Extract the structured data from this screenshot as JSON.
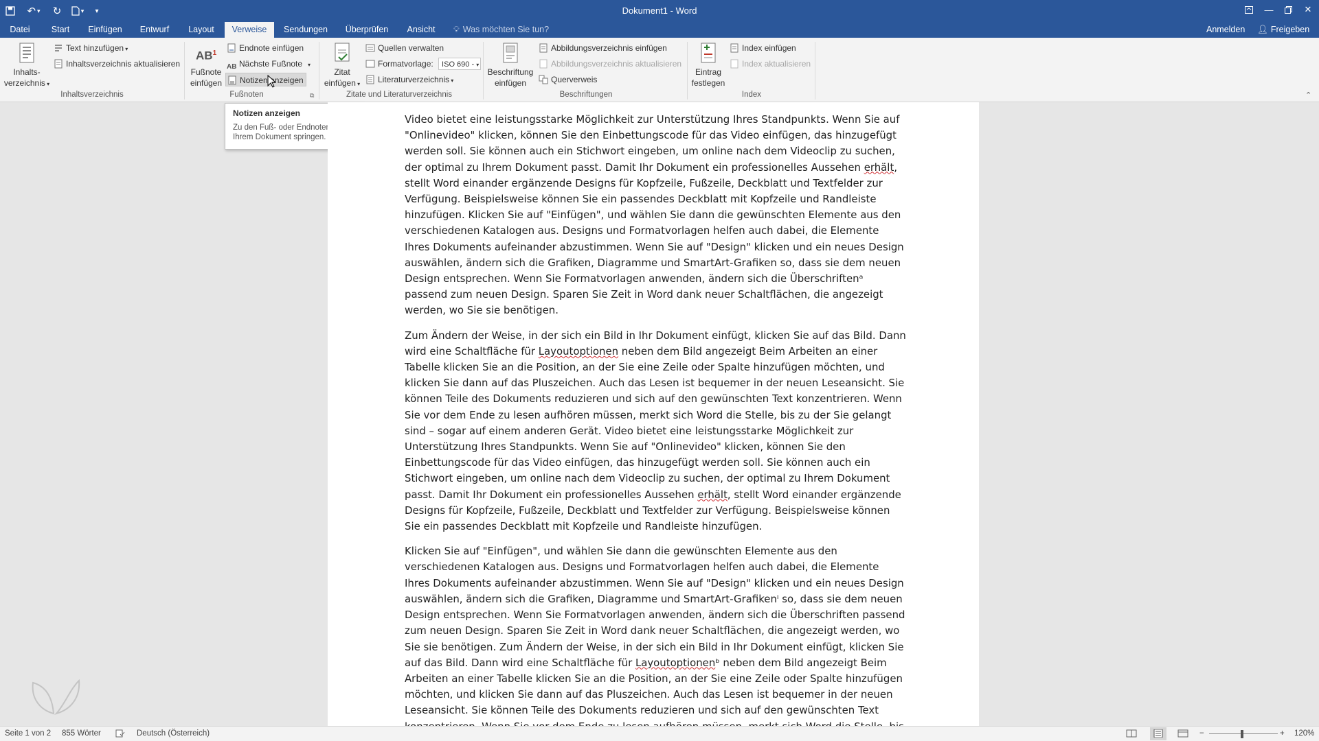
{
  "titlebar": {
    "title": "Dokument1 - Word"
  },
  "tabs": [
    "Datei",
    "Start",
    "Einfügen",
    "Entwurf",
    "Layout",
    "Verweise",
    "Sendungen",
    "Überprüfen",
    "Ansicht"
  ],
  "tellme": "Was möchten Sie tun?",
  "signin": "Anmelden",
  "share": "Freigeben",
  "ribbon": {
    "toc": {
      "button": "Inhalts-",
      "button2": "verzeichnis",
      "add_text": "Text hinzufügen",
      "update": "Inhaltsverzeichnis aktualisieren",
      "label": "Inhaltsverzeichnis"
    },
    "footnotes": {
      "insert_fn": "Fußnote",
      "insert_fn2": "einfügen",
      "insert_endnote": "Endnote einfügen",
      "next_fn": "Nächste Fußnote",
      "show_notes": "Notizen anzeigen",
      "label": "Fußnoten",
      "icon_text": "AB",
      "icon_sup": "1"
    },
    "citations": {
      "insert": "Zitat",
      "insert2": "einfügen",
      "manage": "Quellen verwalten",
      "style_label": "Formatvorlage:",
      "style_value": "ISO 690 -",
      "bibliography": "Literaturverzeichnis",
      "label": "Zitate und Literaturverzeichnis"
    },
    "captions": {
      "insert": "Beschriftung",
      "insert2": "einfügen",
      "insert_tof": "Abbildungsverzeichnis einfügen",
      "update_tof": "Abbildungsverzeichnis aktualisieren",
      "crossref": "Querverweis",
      "label": "Beschriftungen"
    },
    "index": {
      "mark": "Eintrag",
      "mark2": "festlegen",
      "insert": "Index einfügen",
      "update": "Index aktualisieren",
      "label": "Index"
    }
  },
  "tooltip": {
    "title": "Notizen anzeigen",
    "body": "Zu den Fuß- oder Endnoten in Ihrem Dokument springen."
  },
  "document": {
    "p1": "Video bietet eine leistungsstarke Möglichkeit zur Unterstützung Ihres Standpunkts. Wenn Sie auf \"Onlinevideo\" klicken, können Sie den Einbettungscode für das Video einfügen, das hinzugefügt werden soll. Sie können auch ein Stichwort eingeben, um online nach dem Videoclip zu suchen, der optimal zu Ihrem Dokument passt. Damit Ihr Dokument ein professionelles Aussehen ",
    "p1_sq": "erhält",
    "p1_rest": ", stellt Word einander ergänzende Designs für Kopfzeile, Fußzeile, Deckblatt und Textfelder zur Verfügung. Beispielsweise können Sie ein passendes Deckblatt mit Kopfzeile und Randleiste hinzufügen. Klicken Sie auf \"Einfügen\", und wählen Sie dann die gewünschten Elemente aus den verschiedenen Katalogen aus. Designs und Formatvorlagen helfen auch dabei, die Elemente Ihres Dokuments aufeinander abzustimmen. Wenn Sie auf \"Design\" klicken und ein neues Design auswählen, ändern sich die Grafiken, Diagramme und SmartArt-Grafiken so, dass sie dem neuen Design entsprechen. Wenn Sie Formatvorlagen anwenden, ändern sich die Überschriftenᵃ passend zum neuen Design. Sparen Sie Zeit in Word dank neuer Schaltflächen, die angezeigt werden, wo Sie sie benötigen.",
    "p2a": "Zum Ändern der Weise, in der sich ein Bild in Ihr Dokument einfügt, klicken Sie auf das Bild. Dann wird eine Schaltfläche für ",
    "p2_sq": "Layoutoptionen",
    "p2b": " neben dem Bild angezeigt Beim Arbeiten an einer Tabelle klicken Sie an die Position, an der Sie eine Zeile oder Spalte hinzufügen möchten, und klicken Sie dann auf das Pluszeichen. Auch das Lesen ist bequemer in der neuen Leseansicht. Sie können Teile des Dokuments reduzieren und sich auf den gewünschten Text konzentrieren. Wenn Sie vor dem Ende zu lesen aufhören müssen, merkt sich Word die Stelle, bis zu der Sie gelangt sind – sogar auf einem anderen Gerät. Video bietet eine leistungsstarke Möglichkeit zur Unterstützung Ihres Standpunkts. Wenn Sie auf \"Onlinevideo\" klicken, können Sie den Einbettungscode für das Video einfügen, das hinzugefügt werden soll. Sie können auch ein Stichwort eingeben, um online nach dem Videoclip zu suchen, der optimal zu Ihrem Dokument passt. Damit Ihr Dokument ein professionelles Aussehen ",
    "p2_sq2": "erhält",
    "p2c": ", stellt Word einander ergänzende Designs für Kopfzeile, Fußzeile, Deckblatt und Textfelder zur Verfügung. Beispielsweise können Sie ein passendes Deckblatt mit Kopfzeile und Randleiste hinzufügen.",
    "p3a": "Klicken Sie auf \"Einfügen\", und wählen Sie dann die gewünschten Elemente aus den verschiedenen Katalogen aus. Designs und Formatvorlagen helfen auch dabei, die Elemente Ihres Dokuments aufeinander abzustimmen. Wenn Sie auf \"Design\" klicken und ein neues Design auswählen, ändern sich die Grafiken, Diagramme und SmartArt-Grafikenⁱ so, dass sie dem neuen Design entsprechen. Wenn Sie Formatvorlagen anwenden, ändern sich die Überschriften passend zum neuen Design. Sparen Sie Zeit in Word dank neuer Schaltflächen, die angezeigt werden, wo Sie sie benötigen. Zum Ändern der Weise, in der sich ein Bild in Ihr Dokument einfügt, klicken Sie auf das Bild. Dann wird eine Schaltfläche für ",
    "p3_sq": "Layoutoptionen",
    "p3b": "ᵇ neben dem Bild angezeigt Beim Arbeiten an einer Tabelle klicken Sie an die Position, an der Sie eine Zeile oder Spalte hinzufügen möchten, und klicken Sie dann auf das Pluszeichen. Auch das Lesen ist bequemer in der neuen Leseansicht. Sie können Teile des Dokuments reduzieren und sich auf den gewünschten Text konzentrieren. Wenn Sie vor dem Ende zu lesen aufhören müssen, merkt sich Word die Stelle, bis zu der Sie gelangt sind – sogar auf einem anderen Gerät."
  },
  "status": {
    "page": "Seite 1 von 2",
    "words": "855 Wörter",
    "language": "Deutsch (Österreich)",
    "zoom": "120%"
  }
}
